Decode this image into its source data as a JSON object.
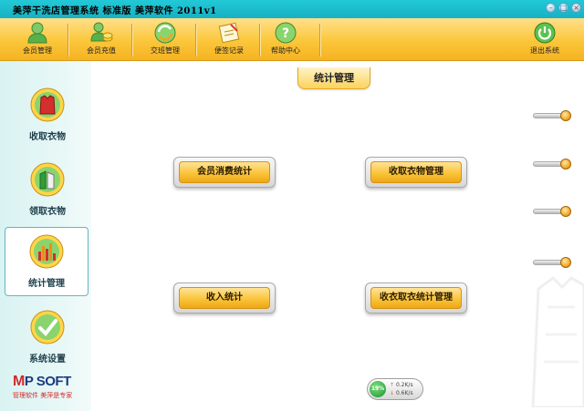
{
  "window": {
    "title": "美萍干洗店管理系统  标准版  美萍软件     2011v1",
    "controls": [
      "minimize",
      "maximize",
      "close"
    ]
  },
  "toolbar": {
    "items": [
      {
        "label": "会员管理",
        "icon": "member-icon"
      },
      {
        "label": "会员充值",
        "icon": "recharge-icon"
      },
      {
        "label": "交班管理",
        "icon": "shift-icon"
      },
      {
        "label": "便签记录",
        "icon": "note-icon"
      },
      {
        "label": "帮助中心",
        "icon": "help-icon"
      }
    ],
    "exit_label": "退出系统"
  },
  "section_title": "统计管理",
  "sidebar": {
    "items": [
      {
        "label": "收取衣物",
        "icon": "collect-clothes-icon"
      },
      {
        "label": "领取衣物",
        "icon": "pickup-clothes-icon"
      },
      {
        "label": "统计管理",
        "icon": "statistics-icon",
        "active": true
      },
      {
        "label": "系统设置",
        "icon": "settings-icon"
      }
    ],
    "logo": {
      "brand": "MPSOFT",
      "slogan": "管理软件  美萍是专家"
    }
  },
  "main": {
    "buttons": [
      {
        "label": "会员消费统计"
      },
      {
        "label": "收取衣物管理"
      },
      {
        "label": "收入统计"
      },
      {
        "label": "收衣取衣统计管理"
      }
    ]
  },
  "net_widget": {
    "percent": "19%",
    "up": "0.2K/s",
    "down": "0.6K/s"
  },
  "colors": {
    "accent": "#fbc63a",
    "titlebar": "#1bbccc",
    "sidebar": "#dff5f3"
  }
}
